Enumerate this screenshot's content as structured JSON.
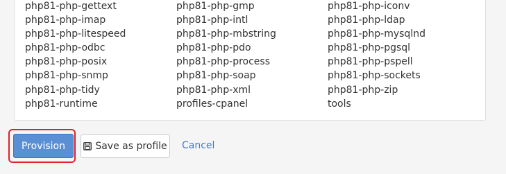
{
  "packages": [
    "php81-php-gettext",
    "php81-php-gmp",
    "php81-php-iconv",
    "php81-php-imap",
    "php81-php-intl",
    "php81-php-ldap",
    "php81-php-litespeed",
    "php81-php-mbstring",
    "php81-php-mysqlnd",
    "php81-php-odbc",
    "php81-php-pdo",
    "php81-php-pgsql",
    "php81-php-posix",
    "php81-php-process",
    "php81-php-pspell",
    "php81-php-snmp",
    "php81-php-soap",
    "php81-php-sockets",
    "php81-php-tidy",
    "php81-php-xml",
    "php81-php-zip",
    "php81-runtime",
    "profiles-cpanel",
    "tools"
  ],
  "actions": {
    "provision_label": "Provision",
    "save_profile_label": "Save as profile",
    "save_profile_icon": "floppy-disk-icon",
    "cancel_label": "Cancel"
  },
  "colors": {
    "primary": "#5b8fd4",
    "highlight": "#e0202a",
    "link": "#3a7bd5"
  }
}
